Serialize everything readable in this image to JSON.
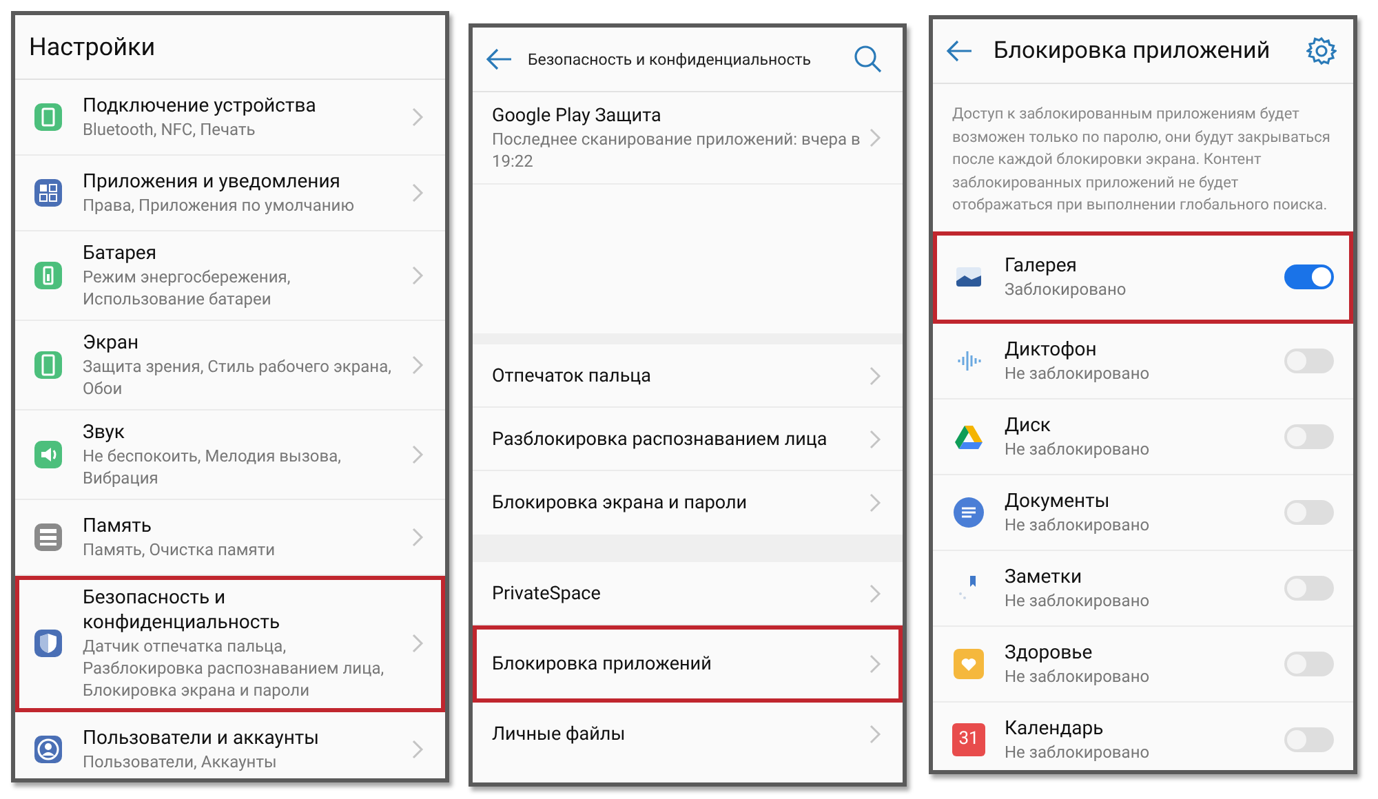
{
  "screens": [
    {
      "kind": "settings",
      "title": "Настройки",
      "items": [
        {
          "title": "Подключение устройства",
          "subtitle": "Bluetooth, NFC, Печать",
          "highlighted": false
        },
        {
          "title": "Приложения и уведомления",
          "subtitle": "Права, Приложения по умолчанию",
          "highlighted": false
        },
        {
          "title": "Батарея",
          "subtitle": "Режим энергосбережения, Использование батареи",
          "highlighted": false
        },
        {
          "title": "Экран",
          "subtitle": "Защита зрения, Стиль рабочего экрана, Обои",
          "highlighted": false
        },
        {
          "title": "Звук",
          "subtitle": "Не беспокоить, Мелодия вызова, Вибрация",
          "highlighted": false
        },
        {
          "title": "Память",
          "subtitle": "Память, Очистка памяти",
          "highlighted": false
        },
        {
          "title": "Безопасность и конфиденциальность",
          "subtitle": "Датчик отпечатка пальца, Разблокировка распознаванием лица, Блокировка экрана и пароли",
          "highlighted": true
        },
        {
          "title": "Пользователи и аккаунты",
          "subtitle": "Пользователи, Аккаунты",
          "highlighted": false
        }
      ]
    },
    {
      "kind": "security",
      "title": "Безопасность и конфиденциальность",
      "groups": [
        {
          "items": [
            {
              "title": "Google Play Защита",
              "subtitle": "Последнее сканирование приложений: вчера в 19:22",
              "highlighted": false
            }
          ]
        },
        {
          "items": [
            {
              "title": "Отпечаток пальца",
              "highlighted": false
            },
            {
              "title": "Разблокировка распознаванием лица",
              "highlighted": false
            },
            {
              "title": "Блокировка экрана и пароли",
              "highlighted": false
            }
          ]
        },
        {
          "items": [
            {
              "title": "PrivateSpace",
              "highlighted": false
            },
            {
              "title": "Блокировка приложений",
              "highlighted": true
            },
            {
              "title": "Личные файлы",
              "highlighted": false
            }
          ]
        }
      ]
    },
    {
      "kind": "app_lock",
      "title": "Блокировка приложений",
      "description": "Доступ к заблокированным приложениям будет возможен только по паролю, они будут закрываться после каждой блокировки экрана. Контент заблокированных приложений не будет отображаться при выполнении глобального поиска.",
      "apps": [
        {
          "name": "Галерея",
          "status": "Заблокировано",
          "locked": true,
          "highlighted": true
        },
        {
          "name": "Диктофон",
          "status": "Не заблокировано",
          "locked": false,
          "highlighted": false
        },
        {
          "name": "Диск",
          "status": "Не заблокировано",
          "locked": false,
          "highlighted": false
        },
        {
          "name": "Документы",
          "status": "Не заблокировано",
          "locked": false,
          "highlighted": false
        },
        {
          "name": "Заметки",
          "status": "Не заблокировано",
          "locked": false,
          "highlighted": false
        },
        {
          "name": "Здоровье",
          "status": "Не заблокировано",
          "locked": false,
          "highlighted": false
        },
        {
          "name": "Календарь",
          "status": "Не заблокировано",
          "locked": false,
          "highlighted": false,
          "icon_text": "31"
        }
      ]
    }
  ]
}
